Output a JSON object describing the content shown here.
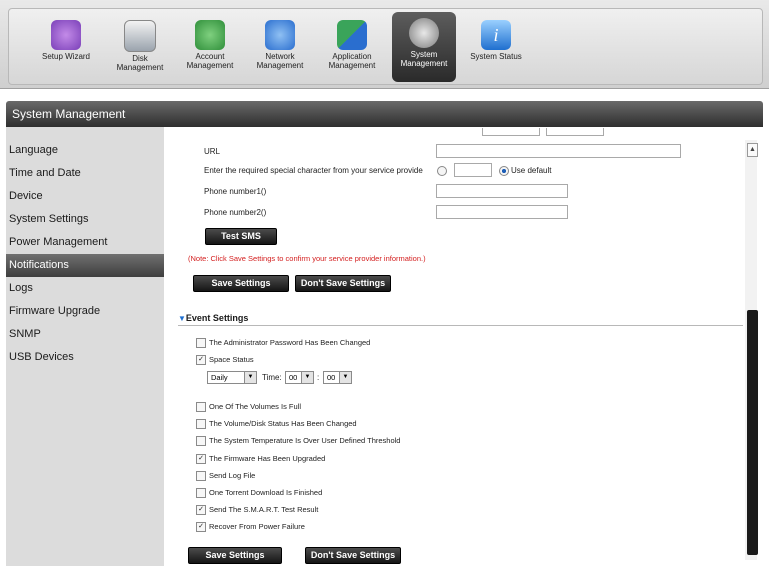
{
  "nav": {
    "items": [
      {
        "label": "Setup Wizard",
        "color": "#7a3fb8"
      },
      {
        "label": "Disk Management",
        "color": "#d33b3b"
      },
      {
        "label": "Account Management",
        "color": "#2f8f3a"
      },
      {
        "label": "Network Management",
        "color": "#2a6ecf"
      },
      {
        "label": "Application Management",
        "color": "#3aa45a"
      },
      {
        "label": "System Management",
        "color": "#5a5a5a",
        "active": true
      },
      {
        "label": "System Status",
        "color": "#1f6fcf"
      }
    ]
  },
  "title": "System Management",
  "sidebar": {
    "items": [
      {
        "label": "Language"
      },
      {
        "label": "Time and Date"
      },
      {
        "label": "Device"
      },
      {
        "label": "System Settings"
      },
      {
        "label": "Power Management"
      },
      {
        "label": "Notifications",
        "active": true
      },
      {
        "label": "Logs"
      },
      {
        "label": "Firmware Upgrade"
      },
      {
        "label": "SNMP"
      },
      {
        "label": "USB Devices"
      }
    ]
  },
  "sms": {
    "url_label": "URL",
    "special_char_label": "Enter the required special character from your service provide",
    "use_default_label": "Use default",
    "phone1_label": "Phone number1()",
    "phone2_label": "Phone number2()",
    "test_button": "Test SMS",
    "note": "(Note: Click Save Settings to confirm your service provider information.)"
  },
  "buttons": {
    "save": "Save Settings",
    "dont_save": "Don't Save Settings"
  },
  "events": {
    "section_title": "Event Settings",
    "items": [
      {
        "label": "The Administrator Password Has Been Changed",
        "checked": false
      },
      {
        "label": "Space Status",
        "checked": true
      },
      {
        "label": "One Of The Volumes Is Full",
        "checked": false
      },
      {
        "label": "The Volume/Disk Status Has Been Changed",
        "checked": false
      },
      {
        "label": "The System Temperature Is Over User Defined Threshold",
        "checked": false
      },
      {
        "label": "The Firmware Has Been Upgraded",
        "checked": true
      },
      {
        "label": "Send Log File",
        "checked": false
      },
      {
        "label": "One Torrent Download Is Finished",
        "checked": false
      },
      {
        "label": "Send The S.M.A.R.T. Test Result",
        "checked": true
      },
      {
        "label": "Recover From Power Failure",
        "checked": true
      }
    ],
    "schedule": {
      "frequency": "Daily",
      "time_label": "Time:",
      "hour": "00",
      "minute": "00",
      "colon": ":"
    }
  }
}
